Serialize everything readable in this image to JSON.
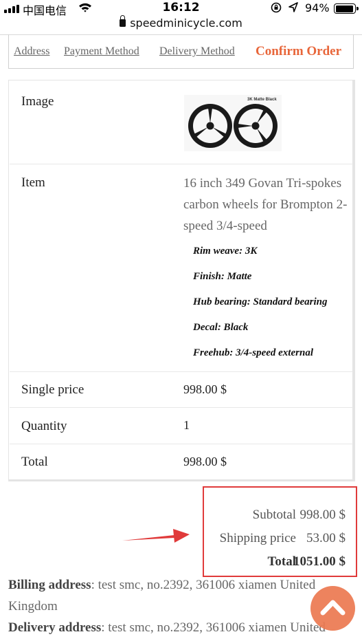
{
  "status_bar": {
    "carrier": "中国电信",
    "time": "16:12",
    "battery": "94%",
    "battery_level": 0.94
  },
  "browser": {
    "url": "speedminicycle.com"
  },
  "steps": {
    "address": "Address",
    "payment": "Payment Method",
    "delivery": "Delivery Method",
    "confirm": "Confirm Order"
  },
  "product": {
    "image_label": "Image",
    "image_caption": "3K Matte Black",
    "item_label": "Item",
    "item_name": "16 inch 349 Govan Tri-spokes carbon wheels for Brompton 2-speed 3/4-speed",
    "options": [
      "Rim weave: 3K",
      "Finish: Matte",
      "Hub bearing: Standard bearing",
      "Decal: Black",
      "Freehub: 3/4-speed external"
    ],
    "single_price_label": "Single price",
    "single_price": "998.00 $",
    "quantity_label": "Quantity",
    "quantity": "1",
    "total_label": "Total",
    "total": "998.00 $"
  },
  "totals": {
    "subtotal_label": "Subtotal",
    "subtotal": "998.00 $",
    "shipping_label": "Shipping price",
    "shipping": "53.00 $",
    "total_label": "Total",
    "total": "1051.00 $"
  },
  "addresses": {
    "billing_label": "Billing address",
    "billing_line1": ": test smc, no.2392, 361006 xiamen United",
    "billing_line2": "Kingdom",
    "delivery_label": "Delivery address",
    "delivery_line1": ": test smc, no.2392, 361006 xiamen United"
  },
  "colors": {
    "accent": "#e8663a",
    "highlight_box": "#e03a3a",
    "fab": "#ec7a52"
  },
  "icons": {
    "scroll_top": "chevron-up-icon"
  }
}
